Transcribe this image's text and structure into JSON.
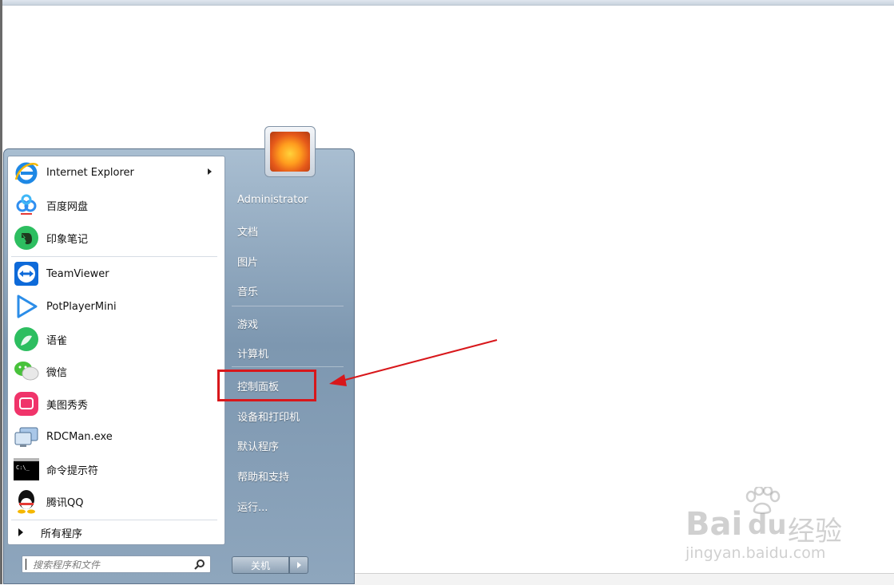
{
  "programs": [
    {
      "label": "Internet Explorer",
      "icon": "internet-explorer-icon",
      "has_submenu": true
    },
    {
      "label": "百度网盘",
      "icon": "baidu-netdisk-icon"
    },
    {
      "label": "印象笔记",
      "icon": "evernote-icon"
    },
    {
      "label": "TeamViewer",
      "icon": "teamviewer-icon"
    },
    {
      "label": "PotPlayerMini",
      "icon": "potplayer-icon"
    },
    {
      "label": "语雀",
      "icon": "yuque-icon"
    },
    {
      "label": "微信",
      "icon": "wechat-icon"
    },
    {
      "label": "美图秀秀",
      "icon": "meitu-icon"
    },
    {
      "label": "RDCMan.exe",
      "icon": "rdcman-icon"
    },
    {
      "label": "命令提示符",
      "icon": "command-prompt-icon"
    },
    {
      "label": "腾讯QQ",
      "icon": "qq-icon"
    }
  ],
  "all_programs_label": "所有程序",
  "search": {
    "placeholder": "搜索程序和文件"
  },
  "right_panel": {
    "user": "Administrator",
    "documents": "文档",
    "pictures": "图片",
    "music": "音乐",
    "games": "游戏",
    "computer": "计算机",
    "control_panel": "控制面板",
    "devices_printers": "设备和打印机",
    "default_programs": "默认程序",
    "help_support": "帮助和支持",
    "run": "运行..."
  },
  "shutdown_label": "关机",
  "watermark": {
    "brand": "Bai",
    "brand2": "du",
    "product": "经验",
    "url": "jingyan.baidu.com"
  },
  "colors": {
    "highlight": "#d8171b",
    "annotation_arrow": "#d8171b"
  }
}
